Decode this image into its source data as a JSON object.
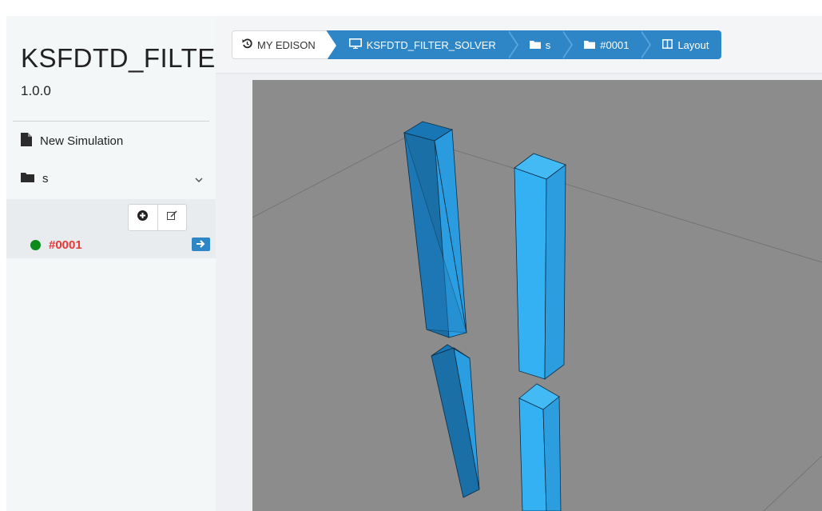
{
  "app": {
    "title": "KSFDTD_FILTE..",
    "version": "1.0.0"
  },
  "sidebar": {
    "new_simulation_label": "New Simulation",
    "folder_label": "s",
    "job": {
      "name": "#0001",
      "status_color": "#0c8a1c"
    }
  },
  "breadcrumb": [
    {
      "icon": "history-icon",
      "label": "MY EDISON"
    },
    {
      "icon": "desktop-icon",
      "label": "KSFDTD_FILTER_SOLVER"
    },
    {
      "icon": "folder-icon",
      "label": "s"
    },
    {
      "icon": "folder-icon",
      "label": "#0001"
    },
    {
      "icon": "columns-icon",
      "label": "Layout"
    }
  ],
  "colors": {
    "accent": "#2f86c7",
    "job_name": "#e83737",
    "viewport_bg": "#8c8c8c",
    "bar_dark": "#1f7fc0",
    "bar_light": "#2aa6ec"
  }
}
